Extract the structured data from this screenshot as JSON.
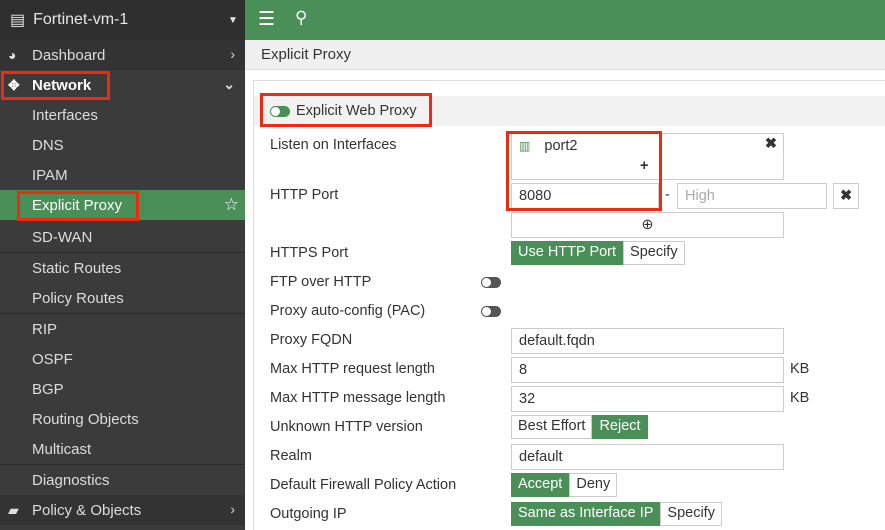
{
  "sidebar": {
    "device": "Fortinet-vm-1",
    "items": {
      "dashboard": "Dashboard",
      "network": "Network",
      "interfaces": "Interfaces",
      "dns": "DNS",
      "ipam": "IPAM",
      "explicit_proxy": "Explicit Proxy",
      "sdwan": "SD-WAN",
      "static_routes": "Static Routes",
      "policy_routes": "Policy Routes",
      "rip": "RIP",
      "ospf": "OSPF",
      "bgp": "BGP",
      "routing_objects": "Routing Objects",
      "multicast": "Multicast",
      "diagnostics": "Diagnostics",
      "policy_objects": "Policy & Objects"
    }
  },
  "breadcrumb": "Explicit Proxy",
  "form": {
    "section": "Explicit Web Proxy",
    "listen_label": "Listen on Interfaces",
    "listen_value": "port2",
    "http_port_label": "HTTP Port",
    "http_port": "8080",
    "high_placeholder": "High",
    "dash": "-",
    "https_label": "HTTPS Port",
    "https_opts": [
      "Use HTTP Port",
      "Specify"
    ],
    "ftp_label": "FTP over HTTP",
    "pac_label": "Proxy auto-config (PAC)",
    "fqdn_label": "Proxy FQDN",
    "fqdn": "default.fqdn",
    "maxreq_label": "Max HTTP request length",
    "maxreq": "8",
    "maxmsg_label": "Max HTTP message length",
    "maxmsg": "32",
    "unit": "KB",
    "unknown_label": "Unknown HTTP version",
    "unknown_opts": [
      "Best Effort",
      "Reject"
    ],
    "realm_label": "Realm",
    "realm": "default",
    "policy_label": "Default Firewall Policy Action",
    "policy_opts": [
      "Accept",
      "Deny"
    ],
    "outgoing_label": "Outgoing IP",
    "outgoing_opts": [
      "Same as Interface IP",
      "Specify"
    ]
  }
}
